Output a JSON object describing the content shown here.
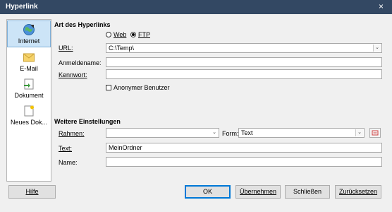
{
  "window": {
    "title": "Hyperlink",
    "close_symbol": "×"
  },
  "sidebar": {
    "items": [
      {
        "label": "Internet",
        "icon": "globe-icon",
        "active": true
      },
      {
        "label": "E-Mail",
        "icon": "envelope-icon",
        "active": false
      },
      {
        "label": "Dokument",
        "icon": "document-icon",
        "active": false
      },
      {
        "label": "Neues Dok...",
        "icon": "new-document-icon",
        "active": false
      }
    ]
  },
  "hyperlink_type": {
    "title": "Art des Hyperlinks",
    "web_label": "Web",
    "ftp_label": "FTP",
    "selected": "FTP",
    "url_label": "URL:",
    "url_value": "C:\\Temp\\",
    "login_label": "Anmeldename:",
    "login_value": "",
    "password_label": "Kennwort:",
    "password_value": "",
    "anonymous_label": "Anonymer Benutzer",
    "anonymous_checked": false
  },
  "further_settings": {
    "title": "Weitere Einstellungen",
    "frame_label": "Rahmen:",
    "frame_value": "",
    "form_label": "Form:",
    "form_value": "Text",
    "text_label": "Text:",
    "text_value": "MeinOrdner",
    "name_label": "Name:",
    "name_value": ""
  },
  "buttons": {
    "help": "Hilfe",
    "ok": "OK",
    "apply": "Übernehmen",
    "close": "Schließen",
    "reset": "Zurücksetzen"
  },
  "colors": {
    "titlebar": "#334863",
    "selection": "#cce4f7",
    "default_button_border": "#0078d7"
  }
}
